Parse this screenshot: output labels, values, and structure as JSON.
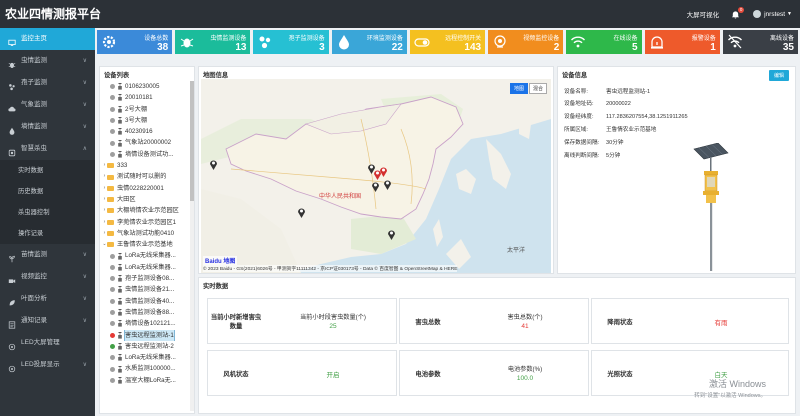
{
  "app": {
    "title": "农业四情测报平台",
    "top_link": "大屏可视化",
    "notification_count": "0",
    "username": "jnrstest"
  },
  "sidebar": {
    "items": [
      {
        "label": "监控主页",
        "active": true,
        "icon": "monitor-icon"
      },
      {
        "label": "虫情监测",
        "icon": "bug-icon",
        "chevron": "∨"
      },
      {
        "label": "孢子监测",
        "icon": "spore-icon",
        "chevron": "∨"
      },
      {
        "label": "气象监测",
        "icon": "cloud-icon",
        "chevron": "∨"
      },
      {
        "label": "墒情监测",
        "icon": "soil-icon",
        "chevron": "∨"
      },
      {
        "label": "智慧杀虫",
        "icon": "smart-icon",
        "chevron": "∧"
      }
    ],
    "subitems": [
      "实时数据",
      "历史数据",
      "杀虫器控制",
      "操作记录"
    ],
    "items_bottom": [
      {
        "label": "苗情监测",
        "icon": "seedling-icon",
        "chevron": "∨"
      },
      {
        "label": "视频监控",
        "icon": "camera-icon",
        "chevron": "∨"
      },
      {
        "label": "叶面分析",
        "icon": "leaf-icon",
        "chevron": "∨"
      },
      {
        "label": "通知记录",
        "icon": "list-icon",
        "chevron": "∨"
      },
      {
        "label": "LED大屏管理",
        "icon": "screen-icon",
        "chevron": ""
      },
      {
        "label": "LED投屏显示",
        "icon": "cast-icon",
        "chevron": "∨"
      }
    ]
  },
  "stats": [
    {
      "label": "设备总数",
      "value": "38",
      "color": "#3b8ad9",
      "icon": "gear-icon"
    },
    {
      "label": "虫情监测设备",
      "value": "13",
      "color": "#1bbc9b",
      "icon": "bug-icon"
    },
    {
      "label": "孢子监测设备",
      "value": "3",
      "color": "#26c0d3",
      "icon": "spore-icon"
    },
    {
      "label": "环境监测设备",
      "value": "22",
      "color": "#3aa6d8",
      "icon": "drop-icon"
    },
    {
      "label": "远程控制开关",
      "value": "143",
      "color": "#f4c020",
      "icon": "switch-icon"
    },
    {
      "label": "视频监控设备",
      "value": "2",
      "color": "#f18d1e",
      "icon": "camera-icon"
    },
    {
      "label": "在线设备",
      "value": "5",
      "color": "#2eb84a",
      "icon": "wifi-icon"
    },
    {
      "label": "报警设备",
      "value": "1",
      "color": "#ee5a2b",
      "icon": "alarm-icon"
    },
    {
      "label": "离线设备",
      "value": "35",
      "color": "#3a3f46",
      "icon": "offline-icon"
    }
  ],
  "device_list": {
    "title": "设备列表",
    "nodes": [
      {
        "label": "0106230005",
        "indent": 1,
        "kind": "dev",
        "dot": "gray"
      },
      {
        "label": "20010181",
        "indent": 1,
        "kind": "dev",
        "dot": "gray"
      },
      {
        "label": "2号大棚",
        "indent": 1,
        "kind": "dev",
        "dot": "gray"
      },
      {
        "label": "3号大棚",
        "indent": 1,
        "kind": "dev",
        "dot": "gray"
      },
      {
        "label": "40230916",
        "indent": 1,
        "kind": "dev",
        "dot": "gray"
      },
      {
        "label": "气象站20000002",
        "indent": 1,
        "kind": "dev",
        "dot": "gray"
      },
      {
        "label": "墒情设备测试功...",
        "indent": 1,
        "kind": "dev",
        "dot": "gray"
      },
      {
        "label": "333",
        "indent": 0,
        "kind": "folder",
        "toggle": "›"
      },
      {
        "label": "测试随时可以删的",
        "indent": 0,
        "kind": "folder",
        "toggle": "›"
      },
      {
        "label": "虫情0228220001",
        "indent": 0,
        "kind": "folder",
        "toggle": "›"
      },
      {
        "label": "大田区",
        "indent": 0,
        "kind": "folder",
        "toggle": "›"
      },
      {
        "label": "大棚墒情农业示范园区",
        "indent": 0,
        "kind": "folder",
        "toggle": "›"
      },
      {
        "label": "李蔸情农业示范园区1",
        "indent": 0,
        "kind": "folder",
        "toggle": "›"
      },
      {
        "label": "气象站测试功能0410",
        "indent": 0,
        "kind": "folder",
        "toggle": "›"
      },
      {
        "label": "王鲁情农业示范基地",
        "indent": 0,
        "kind": "folder",
        "toggle": "⌄"
      },
      {
        "label": "LoRa无线采集器...",
        "indent": 1,
        "kind": "dev",
        "dot": "gray"
      },
      {
        "label": "LoRa无线采集器...",
        "indent": 1,
        "kind": "dev",
        "dot": "gray"
      },
      {
        "label": "孢子监测设备08...",
        "indent": 1,
        "kind": "dev",
        "dot": "gray"
      },
      {
        "label": "虫情监测设备21...",
        "indent": 1,
        "kind": "dev",
        "dot": "gray"
      },
      {
        "label": "虫情监测设备40...",
        "indent": 1,
        "kind": "dev",
        "dot": "gray"
      },
      {
        "label": "虫情监测设备88...",
        "indent": 1,
        "kind": "dev",
        "dot": "gray"
      },
      {
        "label": "墒情设备102121...",
        "indent": 1,
        "kind": "dev",
        "dot": "gray"
      },
      {
        "label": "害虫远程监测站-1",
        "indent": 1,
        "kind": "dev",
        "dot": "red",
        "selected": true
      },
      {
        "label": "害虫远程监测站-2",
        "indent": 1,
        "kind": "dev",
        "dot": "green"
      },
      {
        "label": "LoRa无线采集器...",
        "indent": 1,
        "kind": "dev",
        "dot": "gray"
      },
      {
        "label": "水质监测100000...",
        "indent": 1,
        "kind": "dev",
        "dot": "gray"
      },
      {
        "label": "温室大棚LoRa无...",
        "indent": 1,
        "kind": "dev",
        "dot": "gray"
      }
    ]
  },
  "map": {
    "title": "地图信息",
    "btn_map": "地图",
    "btn_mixed": "混合",
    "country_label": "中华人民共和国",
    "sea_label": "太平洋",
    "logo": "Baidu 地图",
    "copyright": "© 2023 Baidu - GS(2021)6026号 - 甲测资字11111342 - 京ICP证030173号 - Data © 百度智图 & OpenStreetMap & HERE"
  },
  "device_info": {
    "title": "设备信息",
    "detail_button": "编辑",
    "fields": [
      {
        "k": "设备名称:",
        "v": "害虫远程监测站-1"
      },
      {
        "k": "设备地址码:",
        "v": "20000022"
      },
      {
        "k": "设备经纬度:",
        "v": "117.2836207554,38.1251911265"
      },
      {
        "k": "所属区域:",
        "v": "王鲁情农业示范基地"
      },
      {
        "k": "保存数据间隔:",
        "v": "30分钟"
      },
      {
        "k": "离线判断间隔:",
        "v": "5分钟"
      }
    ]
  },
  "realtime": {
    "title": "实时数据",
    "boxes": [
      {
        "key": "当前小时新增害虫数量",
        "metric": "当前小时段害虫数量(个)",
        "value": "25",
        "value_color": "green"
      },
      {
        "key": "害虫总数",
        "metric": "害虫总数(个)",
        "value": "41",
        "value_color": "red"
      },
      {
        "key": "降雨状态",
        "metric": "",
        "value": "有雨",
        "value_color": "red"
      },
      {
        "key": "风机状态",
        "metric": "",
        "value": "开启",
        "value_color": "green"
      },
      {
        "key": "电池参数",
        "metric": "电池参数(%)",
        "value": "100.0",
        "value_color": "green"
      },
      {
        "key": "光照状态",
        "metric": "",
        "value": "白天",
        "value_color": "green"
      }
    ]
  },
  "watermark": {
    "line1": "激活 Windows",
    "line2": "转到\"设置\"以激活 Windows。"
  }
}
